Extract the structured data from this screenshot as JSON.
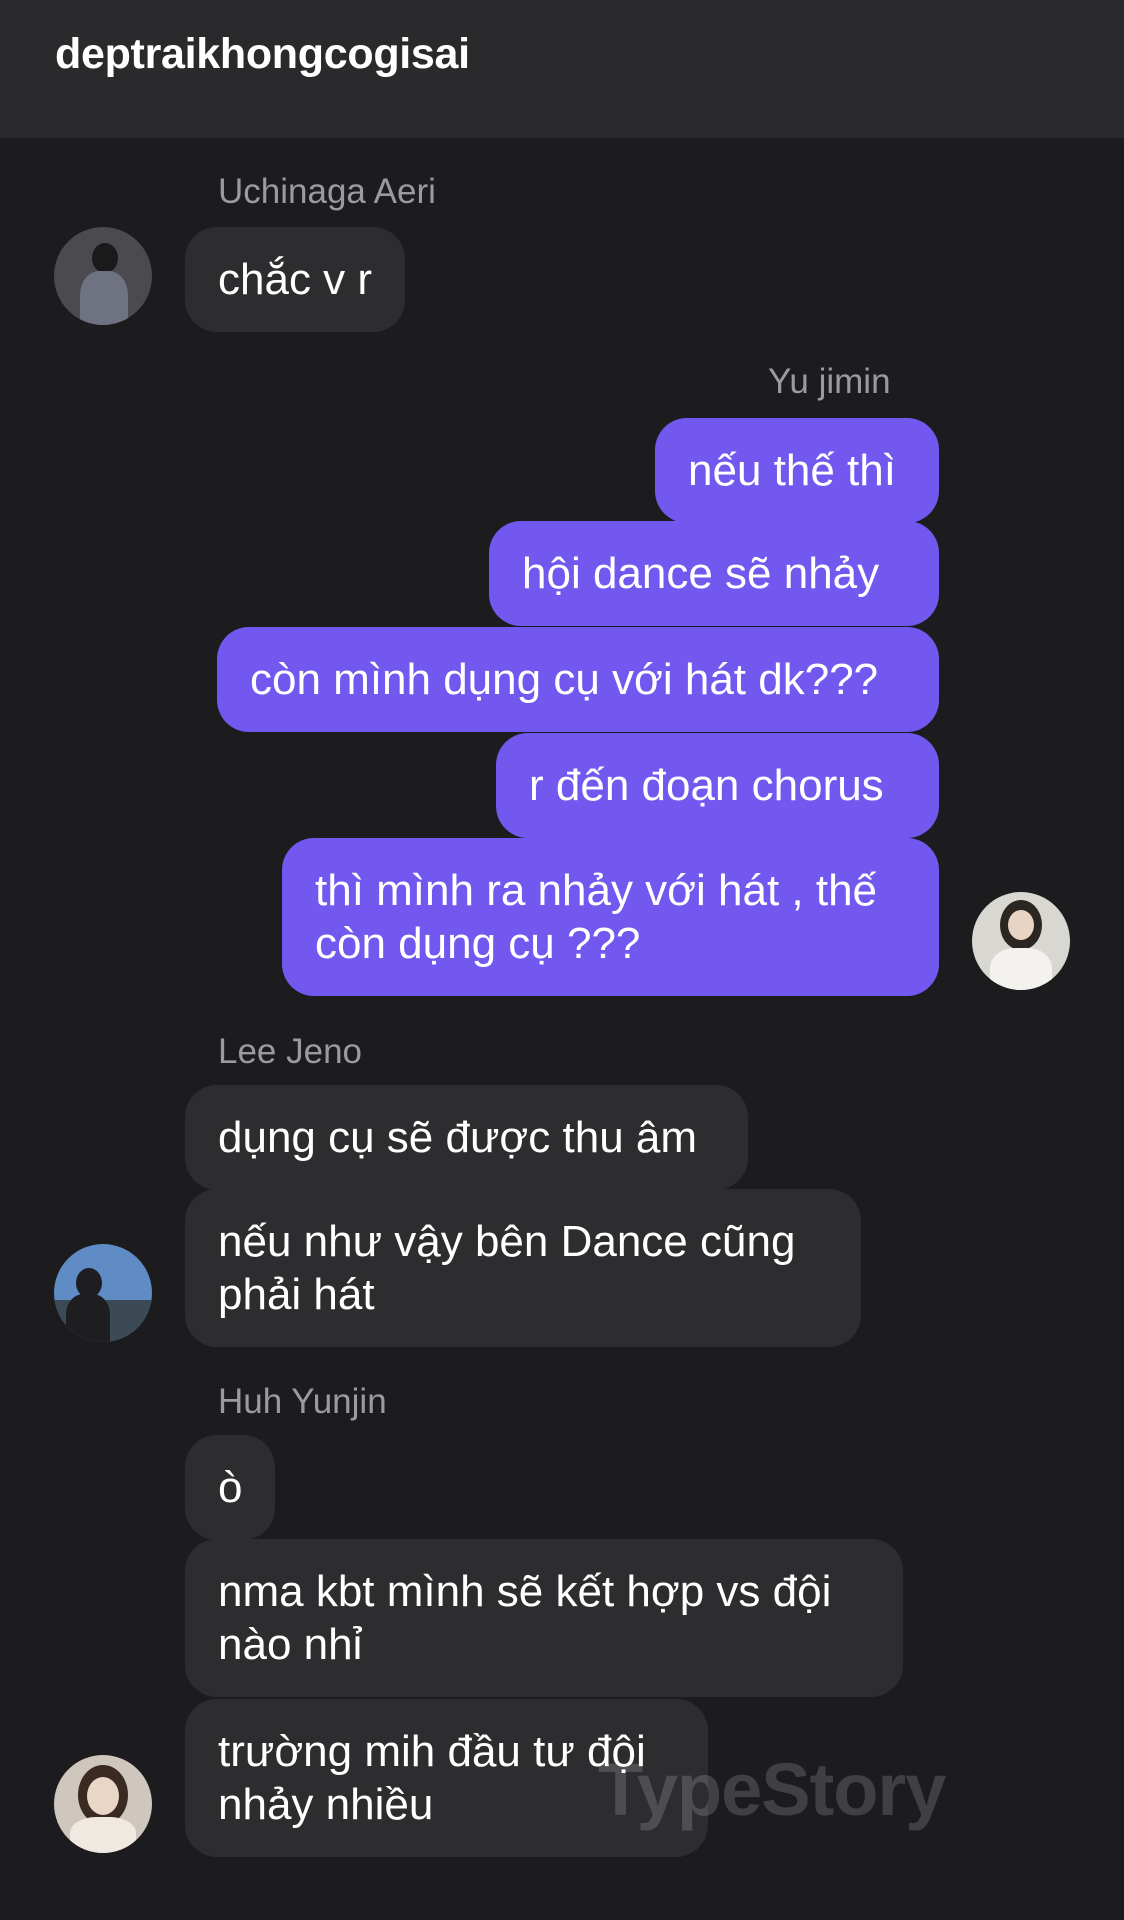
{
  "header": {
    "title": "deptraikhongcogisai"
  },
  "messages": [
    {
      "sender": "Uchinaga Aeri",
      "texts": [
        "chắc v r"
      ]
    },
    {
      "sender": "Yu jimin",
      "texts": [
        "nếu thế thì",
        "hội dance sẽ nhảy",
        "còn mình dụng cụ với hát dk???",
        "r đến đoạn chorus",
        "thì mình ra nhảy với hát , thế còn dụng cụ ???"
      ]
    },
    {
      "sender": "Lee Jeno",
      "texts": [
        "dụng cụ sẽ được thu âm",
        "nếu như vậy bên Dance cũng phải hát"
      ]
    },
    {
      "sender": "Huh Yunjin",
      "texts": [
        "ò",
        "nma kbt mình sẽ kết hợp vs đội nào nhỉ",
        "trường mih đầu tư đội nhảy nhiều"
      ]
    }
  ],
  "watermark": "TypeStory",
  "colors": {
    "outgoing": "#7358f0",
    "incoming": "#2d2d30",
    "background": "#1c1c1e"
  }
}
